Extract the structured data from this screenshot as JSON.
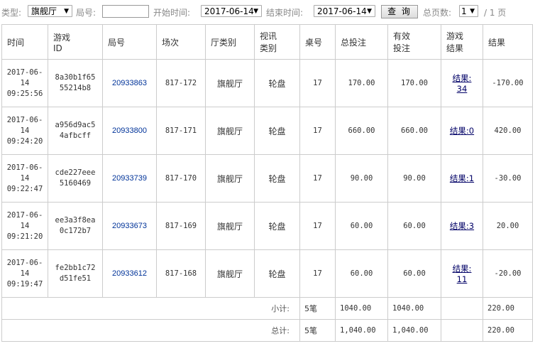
{
  "filters": {
    "type_label": "类型:",
    "type_value": "旗舰厅",
    "round_label": "局号:",
    "round_value": "",
    "start_label": "开始时间:",
    "start_value": "2017-06-14",
    "end_label": "结束时间:",
    "end_value": "2017-06-14",
    "query_label": "查 询",
    "pages_label": "总页数:",
    "page_value": "1",
    "page_total": "/ 1 页"
  },
  "table": {
    "headers": [
      {
        "l1": "时间",
        "l2": ""
      },
      {
        "l1": "游戏",
        "l2": "ID"
      },
      {
        "l1": "局号",
        "l2": ""
      },
      {
        "l1": "场次",
        "l2": ""
      },
      {
        "l1": "厅类别",
        "l2": ""
      },
      {
        "l1": "视讯",
        "l2": "类别"
      },
      {
        "l1": "桌号",
        "l2": ""
      },
      {
        "l1": "总投注",
        "l2": ""
      },
      {
        "l1": "有效",
        "l2": "投注"
      },
      {
        "l1": "游戏",
        "l2": "结果"
      },
      {
        "l1": "结果",
        "l2": ""
      }
    ],
    "rows": [
      {
        "t1": "2017-06-",
        "t2": "14",
        "t3": "09:25:56",
        "g1": "8a30b1f65",
        "g2": "55214b8",
        "round": "20933863",
        "session": "817-172",
        "hall": "旗舰厅",
        "video": "轮盘",
        "table": "17",
        "total": "170.00",
        "valid": "170.00",
        "game_result": "结果:34",
        "gr1": "结果:",
        "gr2": "34",
        "result": "-170.00"
      },
      {
        "t1": "2017-06-",
        "t2": "14",
        "t3": "09:24:20",
        "g1": "a956d9ac5",
        "g2": "4afbcff",
        "round": "20933800",
        "session": "817-171",
        "hall": "旗舰厅",
        "video": "轮盘",
        "table": "17",
        "total": "660.00",
        "valid": "660.00",
        "game_result": "结果:0",
        "gr1": "结果:0",
        "gr2": "",
        "result": "420.00"
      },
      {
        "t1": "2017-06-",
        "t2": "14",
        "t3": "09:22:47",
        "g1": "cde227eee",
        "g2": "5160469",
        "round": "20933739",
        "session": "817-170",
        "hall": "旗舰厅",
        "video": "轮盘",
        "table": "17",
        "total": "90.00",
        "valid": "90.00",
        "game_result": "结果:1",
        "gr1": "结果:1",
        "gr2": "",
        "result": "-30.00"
      },
      {
        "t1": "2017-06-",
        "t2": "14",
        "t3": "09:21:20",
        "g1": "ee3a3f8ea",
        "g2": "0c172b7",
        "round": "20933673",
        "session": "817-169",
        "hall": "旗舰厅",
        "video": "轮盘",
        "table": "17",
        "total": "60.00",
        "valid": "60.00",
        "game_result": "结果:3",
        "gr1": "结果:3",
        "gr2": "",
        "result": "20.00"
      },
      {
        "t1": "2017-06-",
        "t2": "14",
        "t3": "09:19:47",
        "g1": "fe2bb1c72",
        "g2": "d51fe51",
        "round": "20933612",
        "session": "817-168",
        "hall": "旗舰厅",
        "video": "轮盘",
        "table": "17",
        "total": "60.00",
        "valid": "60.00",
        "game_result": "结果:11",
        "gr1": "结果:",
        "gr2": "11",
        "result": "-20.00"
      }
    ],
    "subtotal": {
      "label": "小计:",
      "count": "5笔",
      "total": "1040.00",
      "valid": "1040.00",
      "result": "220.00"
    },
    "grandtotal": {
      "label": "总计:",
      "count": "5笔",
      "total": "1,040.00",
      "valid": "1,040.00",
      "result": "220.00"
    }
  }
}
